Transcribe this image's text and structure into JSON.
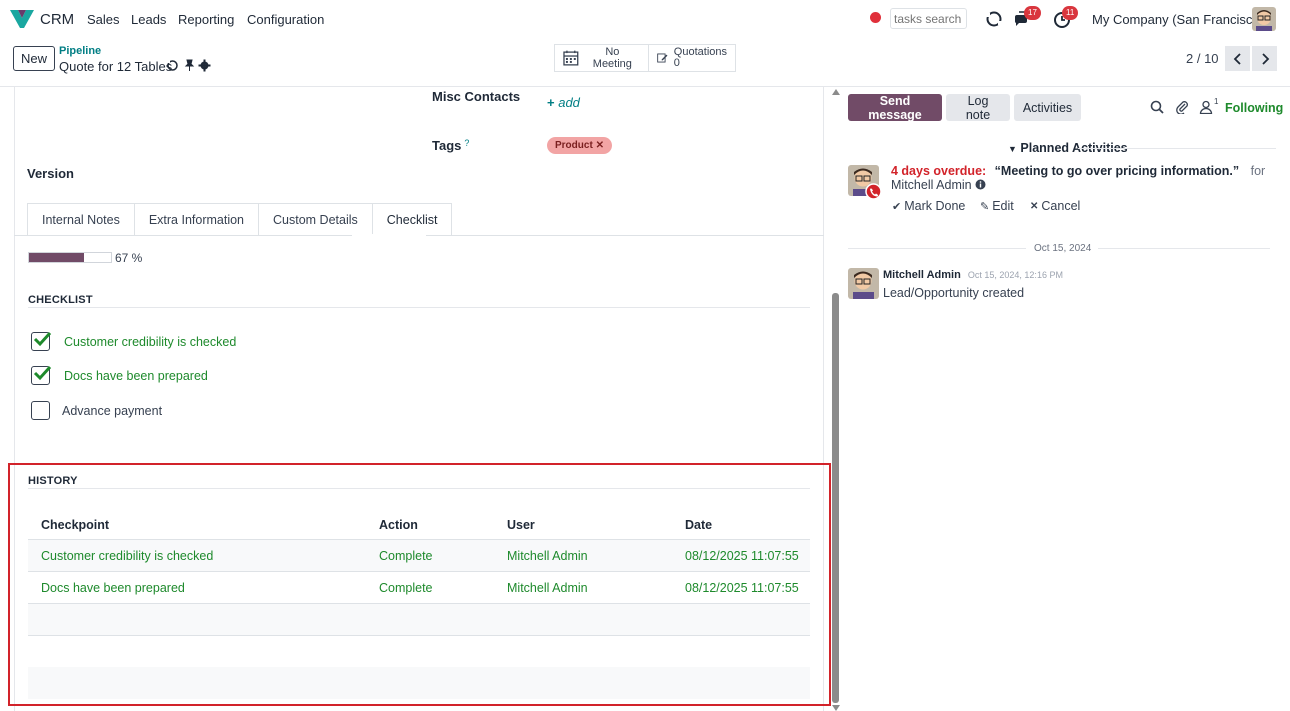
{
  "navbar": {
    "app_name": "CRM",
    "menu": [
      "Sales",
      "Leads",
      "Reporting",
      "Configuration"
    ],
    "search_placeholder": "tasks search",
    "messages_badge": "17",
    "activities_badge": "11",
    "company": "My Company (San Francisco)"
  },
  "control": {
    "new_label": "New",
    "breadcrumb": "Pipeline",
    "title": "Quote for 12 Tables",
    "meeting_label": "No Meeting",
    "quotations_label": "Quotations",
    "quotations_count": "0",
    "pager": "2 / 10"
  },
  "form": {
    "misc_contacts_label": "Misc Contacts",
    "add_label": "add",
    "tags_label": "Tags",
    "tags_help": "?",
    "tags": [
      "Product"
    ],
    "version_label": "Version",
    "tabs": [
      "Internal Notes",
      "Extra Information",
      "Custom Details",
      "Checklist"
    ],
    "active_tab": "Checklist",
    "progress_percent": 67,
    "progress_text": "67 %",
    "checklist_heading": "CHECKLIST",
    "checklist": [
      {
        "label": "Customer credibility is checked",
        "checked": true
      },
      {
        "label": "Docs have been prepared",
        "checked": true
      },
      {
        "label": "Advance payment",
        "checked": false
      }
    ],
    "history_heading": "HISTORY",
    "history_columns": [
      "Checkpoint",
      "Action",
      "User",
      "Date"
    ],
    "history_rows": [
      {
        "checkpoint": "Customer credibility is checked",
        "action": "Complete",
        "user": "Mitchell Admin",
        "date": "08/12/2025 11:07:55"
      },
      {
        "checkpoint": "Docs have been prepared",
        "action": "Complete",
        "user": "Mitchell Admin",
        "date": "08/12/2025 11:07:55"
      }
    ]
  },
  "chatter": {
    "send_message": "Send message",
    "log_note": "Log note",
    "activities": "Activities",
    "follower_count": "1",
    "following": "Following",
    "planned_heading": "Planned Activities",
    "activity": {
      "overdue": "4 days overdue:",
      "summary": "“Meeting to go over pricing information.”",
      "for_word": "for",
      "assignee": "Mitchell Admin",
      "mark_done": "Mark Done",
      "edit": "Edit",
      "cancel": "Cancel"
    },
    "date_separator": "Oct 15, 2024",
    "message": {
      "author": "Mitchell Admin",
      "date": "Oct 15, 2024, 12:16 PM",
      "body": "Lead/Opportunity created"
    }
  },
  "colors": {
    "primary": "#714b67",
    "success": "#1e8a2c",
    "danger": "#d2232a",
    "link": "#017e84"
  }
}
